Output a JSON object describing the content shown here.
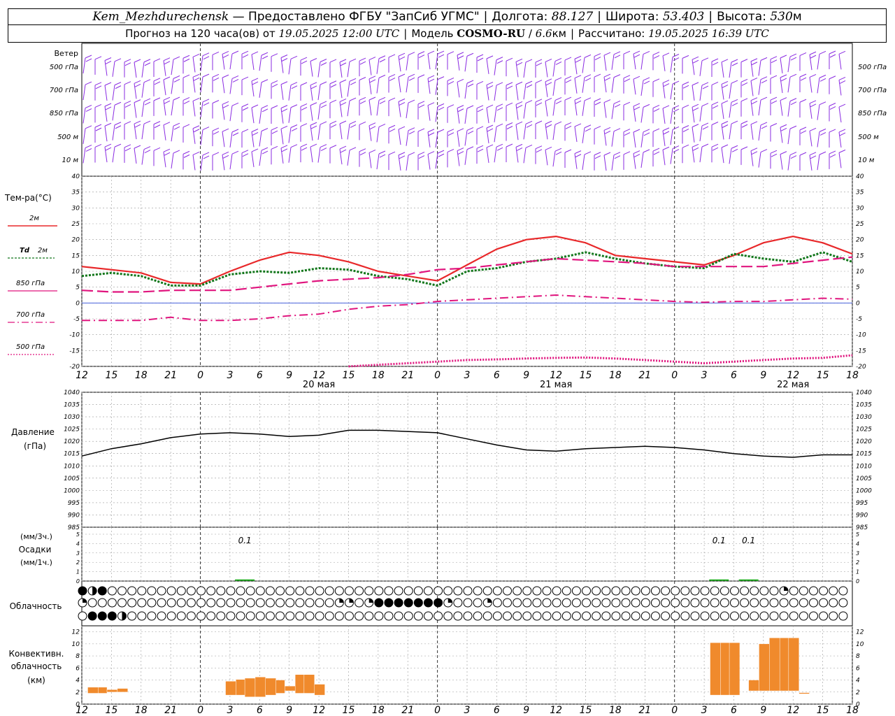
{
  "header": {
    "station": "Kem_Mezhdurechensk",
    "provided": "— Предоставлено ФГБУ \"ЗапСиб УГМС\"",
    "lon_label": "Долгота:",
    "lon": "88.127",
    "lat_label": "Широта:",
    "lat": "53.403",
    "alt_label": "Высота:",
    "alt": "530",
    "alt_unit": "м",
    "forecast_label": "Прогноз на 120 часа(ов) от",
    "forecast_time": "19.05.2025 12:00 UTC",
    "model_label": "Модель",
    "model": "COSMO-RU",
    "model_res": "6.6",
    "model_res_unit": "км",
    "calc_label": "Рассчитано:",
    "calc_time": "19.05.2025 16:39 UTC"
  },
  "time_axis": {
    "ticks": [
      "12",
      "15",
      "18",
      "21",
      "0",
      "3",
      "6",
      "9",
      "12",
      "15",
      "18",
      "21",
      "0",
      "3",
      "6",
      "9",
      "12",
      "15",
      "18",
      "21",
      "0",
      "3",
      "6",
      "9",
      "12",
      "15",
      "18"
    ],
    "days": [
      {
        "label": "20 мая",
        "tick": 8
      },
      {
        "label": "21 мая",
        "tick": 16
      },
      {
        "label": "22 мая",
        "tick": 24
      }
    ],
    "midnights": [
      4,
      12,
      20
    ]
  },
  "wind": {
    "title": "Ветер",
    "levels": [
      "500 гПа",
      "700 гПа",
      "850 гПа",
      "500 м",
      "10 м"
    ]
  },
  "colors": {
    "t2m": "#e8282a",
    "td": "#11761a",
    "p850": "#e0157e",
    "p700": "#e0157e",
    "p500": "#e0157e",
    "wind": "#8a2be2",
    "pressure": "#000000",
    "precip": "#22b022",
    "convective": "#f08a2c",
    "grid": "#9a9a9a",
    "zero": "#2f4bd6"
  },
  "chart_data": [
    {
      "type": "line",
      "ylabel": "Тем-ра(°C)",
      "ylim": [
        -20,
        40
      ],
      "yticks": [
        "40",
        "35",
        "30",
        "25",
        "20",
        "15",
        "10",
        "5",
        "0",
        "-5",
        "-10",
        "-15",
        "-20"
      ],
      "x": [
        0,
        1,
        2,
        3,
        4,
        5,
        6,
        7,
        8,
        9,
        10,
        11,
        12,
        13,
        14,
        15,
        16,
        17,
        18,
        19,
        20,
        21,
        22,
        23,
        24,
        25,
        26
      ],
      "series": [
        {
          "name": "2м",
          "style": "solid",
          "values": [
            11.5,
            10.5,
            9.5,
            6.5,
            6,
            10,
            13.5,
            16,
            15,
            13,
            10,
            8.5,
            7,
            12,
            17,
            20,
            21,
            19,
            15,
            14,
            13,
            12,
            15,
            19,
            21,
            19,
            15.5
          ]
        },
        {
          "name": "Td 2м",
          "style": "dotted",
          "values": [
            8.5,
            9.5,
            8.5,
            5.5,
            5.5,
            9,
            10,
            9.5,
            11,
            10.5,
            8.5,
            7.5,
            5.5,
            10,
            11,
            13,
            14,
            16,
            14,
            12.5,
            11.5,
            11,
            15.5,
            14,
            13,
            16,
            13
          ]
        },
        {
          "name": "850 гПа",
          "style": "dashed",
          "values": [
            4,
            3.5,
            3.5,
            4,
            4,
            4,
            5,
            6,
            7,
            7.5,
            8,
            9,
            10.5,
            11,
            12,
            13,
            14,
            13.5,
            13,
            12.5,
            11.5,
            11.5,
            11.5,
            11.5,
            12.5,
            13.5,
            14.5
          ]
        },
        {
          "name": "700 гПа",
          "style": "dashdot",
          "values": [
            -5.5,
            -5.5,
            -5.5,
            -4.5,
            -5.5,
            -5.5,
            -5,
            -4,
            -3.5,
            -2,
            -1,
            -0.5,
            0.5,
            1,
            1.5,
            2,
            2.5,
            2,
            1.5,
            1,
            0.5,
            0.2,
            0.5,
            0.5,
            1,
            1.5,
            1.2
          ]
        },
        {
          "name": "500 гПа",
          "style": "densedot",
          "values": [
            null,
            null,
            null,
            null,
            null,
            null,
            null,
            null,
            null,
            -20,
            -19.5,
            -19,
            -18.5,
            -18,
            -17.8,
            -17.5,
            -17.3,
            -17.2,
            -17.5,
            -18,
            -18.5,
            -19,
            -18.5,
            -18,
            -17.5,
            -17.3,
            -16.5
          ]
        }
      ]
    },
    {
      "type": "line",
      "ylabel": "Давление",
      "yunit": "(гПа)",
      "ylim": [
        985,
        1040
      ],
      "yticks": [
        "1040",
        "1035",
        "1030",
        "1025",
        "1020",
        "1015",
        "1010",
        "1005",
        "1000",
        "995",
        "990",
        "985"
      ],
      "x": [
        0,
        1,
        2,
        3,
        4,
        5,
        6,
        7,
        8,
        9,
        10,
        11,
        12,
        13,
        14,
        15,
        16,
        17,
        18,
        19,
        20,
        21,
        22,
        23,
        24,
        25,
        26
      ],
      "series": [
        {
          "name": "Давление",
          "values": [
            1014,
            1017,
            1019,
            1021.5,
            1023,
            1023.5,
            1023,
            1022,
            1022.5,
            1024.5,
            1024.5,
            1024,
            1023.5,
            1021,
            1018.5,
            1016.5,
            1016,
            1017,
            1017.5,
            1018,
            1017.5,
            1016.5,
            1015,
            1014,
            1013.5,
            1014.5,
            1014.5
          ]
        }
      ]
    },
    {
      "type": "bar",
      "ylabel": "Осадки",
      "yunit_top": "(мм/3ч.)",
      "yunit_bottom": "(мм/1ч.)",
      "ylim": [
        0,
        5
      ],
      "yticks": [
        "5",
        "4",
        "3",
        "2",
        "1",
        "0"
      ],
      "bars": [
        {
          "x": 5.5,
          "value": 0.1,
          "label": "0.1"
        },
        {
          "x": 21.5,
          "value": 0.1,
          "label": "0.1"
        },
        {
          "x": 22.5,
          "value": 0.1,
          "label": "0.1"
        }
      ]
    },
    {
      "type": "bar",
      "ylabel": "Конвективн. облачность (км)",
      "ylim": [
        0,
        13
      ],
      "yticks": [
        "12",
        "10",
        "8",
        "6",
        "4",
        "2",
        "0"
      ],
      "ranges": [
        {
          "x0": 0.2,
          "x1": 0.55,
          "lo": 1.8,
          "hi": 2.8
        },
        {
          "x0": 0.55,
          "x1": 0.85,
          "lo": 1.8,
          "hi": 2.8
        },
        {
          "x0": 0.85,
          "x1": 1.2,
          "lo": 2,
          "hi": 2.4
        },
        {
          "x0": 1.2,
          "x1": 1.55,
          "lo": 2,
          "hi": 2.6
        },
        {
          "x0": 4.85,
          "x1": 5.2,
          "lo": 1.5,
          "hi": 3.8
        },
        {
          "x0": 5.2,
          "x1": 5.5,
          "lo": 1.5,
          "hi": 4.1
        },
        {
          "x0": 5.5,
          "x1": 5.85,
          "lo": 1.2,
          "hi": 4.3
        },
        {
          "x0": 5.85,
          "x1": 6.2,
          "lo": 1.2,
          "hi": 4.5
        },
        {
          "x0": 6.2,
          "x1": 6.55,
          "lo": 1.5,
          "hi": 4.3
        },
        {
          "x0": 6.55,
          "x1": 6.85,
          "lo": 1.8,
          "hi": 4
        },
        {
          "x0": 6.85,
          "x1": 7.2,
          "lo": 2.2,
          "hi": 3
        },
        {
          "x0": 7.2,
          "x1": 7.5,
          "lo": 1.8,
          "hi": 4.9
        },
        {
          "x0": 7.5,
          "x1": 7.85,
          "lo": 1.8,
          "hi": 4.9
        },
        {
          "x0": 7.85,
          "x1": 8.2,
          "lo": 1.5,
          "hi": 3.3
        },
        {
          "x0": 21.2,
          "x1": 21.55,
          "lo": 1.5,
          "hi": 10.2
        },
        {
          "x0": 21.55,
          "x1": 21.85,
          "lo": 1.5,
          "hi": 10.2
        },
        {
          "x0": 21.85,
          "x1": 22.2,
          "lo": 1.5,
          "hi": 10.2
        },
        {
          "x0": 22.5,
          "x1": 22.85,
          "lo": 2.2,
          "hi": 4
        },
        {
          "x0": 22.85,
          "x1": 23.2,
          "lo": 2.2,
          "hi": 10
        },
        {
          "x0": 23.2,
          "x1": 23.55,
          "lo": 2.2,
          "hi": 11
        },
        {
          "x0": 23.55,
          "x1": 23.85,
          "lo": 2.2,
          "hi": 11
        },
        {
          "x0": 23.85,
          "x1": 24.2,
          "lo": 2.2,
          "hi": 11
        },
        {
          "x0": 24.2,
          "x1": 24.55,
          "lo": 1.7,
          "hi": 1.9
        }
      ]
    }
  ],
  "labels": {
    "temp_title": "Тем-ра(°C)",
    "legend": [
      "2м",
      "Td",
      "2м",
      "850 гПа",
      "700 гПа",
      "500 гПа"
    ],
    "pressure_title": "Давление",
    "pressure_unit": "(гПа)",
    "precip_top": "(мм/3ч.)",
    "precip_mid": "Осадки",
    "precip_bot": "(мм/1ч.)",
    "cloud_title": "Облачность",
    "conv1": "Конвективн.",
    "conv2": "облачность",
    "conv3": "(км)"
  },
  "cloudiness": {
    "rows": [
      "FHFOOOOOOOOOOOOOOOOOOOOOOOOOOOOOOOOOOOOOOOOOOOOOOOOOOOOOOOOOOOOOOOOOOOOQOOOOOOOOOOOOOOOTOOFHOOOFFTFFOFTOOOOOTFFOFFFFFFFOFFFFFF",
      "QOOOOOOOOOOOOOOOOOOOOOOOOOQQOQFFFFFFFQOOOQOOOOOOOOOOOOOOOOOOOOOOOOOOOOOOOOOOOOOOOOOOOOOOOOOOOOOOOOOOOFFOOOOOOOOOOOOOOOQOFOQOFFFFQ",
      "OFFFHOOOOOOOOOOOOOOOOOOOOOOOOOOOOOOOOOOOOOOOOOOOOOOOOOOOOOOOOOOOOOOOOOOOOOOOOOOOOOOOOOOOOOOOOOOOOOOOOOOOOOOOOOOOOOOOOOOOTOOOOOOOO"
    ]
  }
}
